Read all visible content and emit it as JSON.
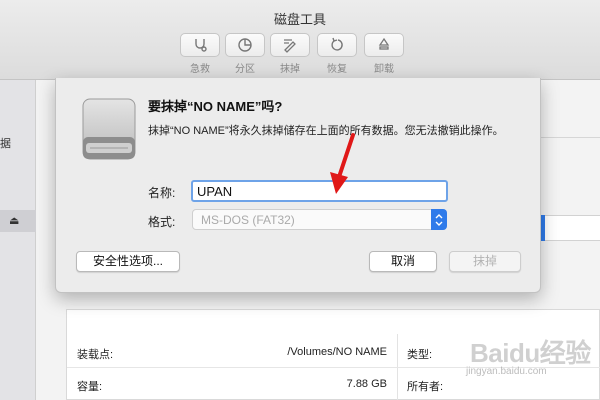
{
  "window": {
    "title": "磁盘工具"
  },
  "toolbar": {
    "items": [
      {
        "label": "急救",
        "icon": "stethoscope-icon"
      },
      {
        "label": "分区",
        "icon": "pie-partition-icon"
      },
      {
        "label": "抹掉",
        "icon": "erase-icon"
      },
      {
        "label": "恢复",
        "icon": "restore-icon"
      },
      {
        "label": "卸载",
        "icon": "unmount-icon"
      }
    ]
  },
  "sidebar": {
    "partial_text": "据",
    "eject_icon": "eject-icon"
  },
  "dialog": {
    "title": "要抹掉“NO NAME”吗?",
    "message": "抹掉“NO NAME”将永久抹掉储存在上面的所有数据。您无法撤销此操作。",
    "name_label": "名称:",
    "name_value": "UPAN",
    "format_label": "格式:",
    "format_value": "MS-DOS (FAT32)",
    "security_button": "安全性选项...",
    "cancel_button": "取消",
    "erase_button": "抹掉",
    "disk_icon": "external-disk-icon"
  },
  "info": {
    "rows": [
      {
        "key": "装载点:",
        "value": "/Volumes/NO NAME",
        "key2": "类型:"
      },
      {
        "key": "容量:",
        "value": "7.88 GB",
        "key2": "所有者:"
      }
    ]
  },
  "watermark": {
    "main": "Baidu经验",
    "sub": "jingyan.baidu.com"
  },
  "colors": {
    "accent": "#2f7bea",
    "arrow": "#e01818",
    "focus_ring": "#6ea3e8"
  }
}
